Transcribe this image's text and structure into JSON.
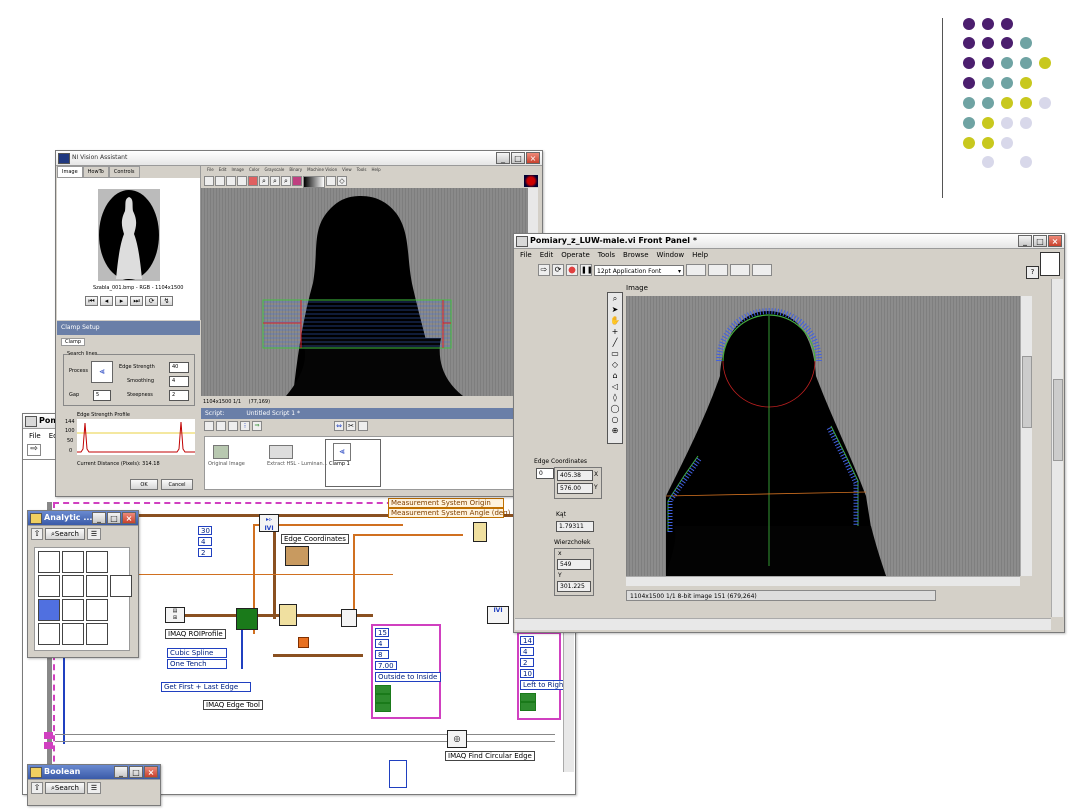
{
  "decor": {
    "purple": "#4b1e6e",
    "teal": "#6fa3a3",
    "yellow": "#c8c81e",
    "lavender": "#d8d8ea"
  },
  "vision_assistant": {
    "title": "NI Vision Assistant",
    "menu": [
      "File",
      "Edit",
      "Image",
      "Color",
      "Grayscale",
      "Binary",
      "Machine Vision",
      "View",
      "Tools",
      "Help"
    ],
    "tabs": [
      "Image",
      "HowTo",
      "Controls"
    ],
    "thumb_caption": "Szabla_001.bmp - RGB - 1104x1500",
    "status_left": "1104x1500 1/1",
    "status_coords": "(77,169)",
    "script_label": "Script:",
    "script_name": "Untitled Script 1 *",
    "script_steps": [
      "Original Image",
      "Extract HSL - Luminan...",
      "Clamp 1"
    ],
    "clamp_setup_title": "Clamp Setup",
    "clamp_tab": "Clamp",
    "search_lines": "Search lines",
    "process_label": "Process",
    "gap_label": "Gap",
    "gap_value": "5",
    "edge_strength_label": "Edge Strength",
    "edge_strength_value": "40",
    "smoothing_label": "Smoothing",
    "smoothing_value": "4",
    "steepness_label": "Steepness",
    "steepness_value": "2",
    "profile_title": "Edge Strength Profile",
    "profile_yticks": [
      "144",
      "100",
      "50",
      "0"
    ],
    "current_distance": "Current Distance (Pixels): 314.18",
    "ok_label": "OK",
    "cancel_label": "Cancel"
  },
  "front_panel": {
    "title": "Pomiary_z_LUW-male.vi Front Panel *",
    "menu": [
      "File",
      "Edit",
      "Operate",
      "Tools",
      "Browse",
      "Window",
      "Help"
    ],
    "font_select": "12pt Application Font",
    "image_label": "Image",
    "edge_coords_label": "Edge Coordinates",
    "edge_index": "0",
    "edge_x": "405.38",
    "edge_x_label": "X",
    "edge_y": "576.00",
    "edge_y_label": "Y",
    "kat_label": "Kąt",
    "kat_value": "1.79311",
    "wierz_label": "Wierzchołek",
    "wx_label": "x",
    "wx_value": "549",
    "wy_label": "Y",
    "wy_value": "301.225",
    "status": "1104x1500 1/1 8-bit image 151    (679,264)"
  },
  "diagram": {
    "title": "Pomi",
    "menu": [
      "File",
      "Edi"
    ],
    "labels": {
      "edge_coordinates": "Edge Coordinates",
      "roi_profile": "IMAQ ROIProfile",
      "edge_tool": "IMAQ Edge Tool",
      "find_circular_edge": "IMAQ Find Circular Edge",
      "measurement_origin": "Measurement System Origin",
      "measurement_angle": "Measurement System Angle (deg)"
    },
    "constants": {
      "c30": "30",
      "c4": "4",
      "c2": "2",
      "c15": "15",
      "c8": "8",
      "c7": "7.00",
      "cubic": "Cubic Spline",
      "one_tench": "One Tench",
      "get_first_last": "Get First + Last Edge",
      "outside_inside": "Outside to Inside",
      "left_right": "Left to Right",
      "c14": "14",
      "c10": "10",
      "vi": "IVI"
    }
  },
  "analytic_palette": {
    "title": "Analytic ...",
    "search": "Search"
  },
  "boolean_palette": {
    "title": "Boolean",
    "search": "Search"
  }
}
